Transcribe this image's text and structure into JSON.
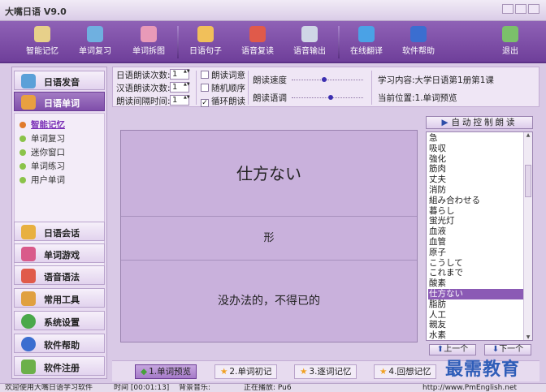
{
  "app": {
    "title": "大嘴日语 V9.0"
  },
  "toolbar": {
    "buttons": [
      {
        "label": "智能记忆",
        "icon": "book-icon",
        "color": "#e7d08a"
      },
      {
        "label": "单词复习",
        "icon": "pencil-icon",
        "color": "#6fb0e0"
      },
      {
        "label": "单词拆图",
        "icon": "puzzle-icon",
        "color": "#e89ab8"
      },
      {
        "label": "日语句子",
        "icon": "people-icon",
        "color": "#f1c05a"
      },
      {
        "label": "语音复读",
        "icon": "person-icon",
        "color": "#e05a4a"
      },
      {
        "label": "语音输出",
        "icon": "speaker-icon",
        "color": "#cfd6e6"
      },
      {
        "label": "在线翻译",
        "icon": "globe-icon",
        "color": "#4aa2e6"
      },
      {
        "label": "软件帮助",
        "icon": "help-icon",
        "color": "#3b6ed0"
      },
      {
        "label": "退出",
        "icon": "exit-icon",
        "color": "#7bc06a"
      }
    ]
  },
  "sidebar": {
    "top": [
      {
        "label": "日语发音",
        "icon": "pronunciation-icon",
        "active": false
      },
      {
        "label": "日语单词",
        "icon": "words-icon",
        "active": true
      }
    ],
    "sub_items": [
      {
        "label": "智能记忆",
        "active": true
      },
      {
        "label": "单词复习",
        "active": false
      },
      {
        "label": "迷你窗口",
        "active": false
      },
      {
        "label": "单词练习",
        "active": false
      },
      {
        "label": "用户单词",
        "active": false
      }
    ],
    "bottom": [
      {
        "label": "日语会话",
        "icon": "conversation-icon"
      },
      {
        "label": "单词游戏",
        "icon": "game-icon"
      },
      {
        "label": "语音语法",
        "icon": "grammar-icon"
      },
      {
        "label": "常用工具",
        "icon": "tools-icon"
      },
      {
        "label": "系统设置",
        "icon": "settings-icon"
      },
      {
        "label": "软件帮助",
        "icon": "help-icon"
      },
      {
        "label": "软件注册",
        "icon": "register-icon"
      }
    ]
  },
  "controls": {
    "jp_read_count_label": "日语朗读次数:",
    "jp_read_count": "1",
    "cn_read_count_label": "汉语朗读次数:",
    "cn_read_count": "1",
    "interval_label": "朗读间隔时间:",
    "interval": "1",
    "chk_read_meaning": "朗读词意",
    "chk_random": "随机顺序",
    "chk_loop": "循环朗读",
    "chk_loop_checked": true,
    "speed_label": "朗读速度",
    "speed_level": 0.45,
    "tone_label": "朗读语调",
    "tone_level": 0.55,
    "study_content": "学习内容:大学日语第1册第1课",
    "position": "当前位置:1.单词预览"
  },
  "display": {
    "word": "仕方ない",
    "type": "形",
    "meaning": "没办法的，不得已的"
  },
  "wordlist": {
    "auto_read_label": "自动控制朗读",
    "items": [
      "急",
      "吸収",
      "強化",
      "筋肉",
      "丈夫",
      "消防",
      "組み合わせる",
      "暮らし",
      "蛍光灯",
      "血液",
      "血管",
      "原子",
      "こうして",
      "これまで",
      "酸素",
      "仕方ない",
      "脂肪",
      "人工",
      "親友",
      "水素"
    ],
    "selected_index": 15,
    "prev_label": "上一个",
    "next_label": "下一个"
  },
  "tabs": [
    {
      "label": "1.单词预览",
      "active": true
    },
    {
      "label": "2.单词初记",
      "active": false
    },
    {
      "label": "3.逐词记忆",
      "active": false
    },
    {
      "label": "4.回想记忆",
      "active": false
    }
  ],
  "status": {
    "welcome": "欢迎使用大嘴日语学习软件",
    "time": "时间 [00:01:13]",
    "bgm": "背景音乐:",
    "playing": "正在播放: Pu6",
    "url": "http://www.PmEnglish.net"
  },
  "watermark": "最需教育"
}
